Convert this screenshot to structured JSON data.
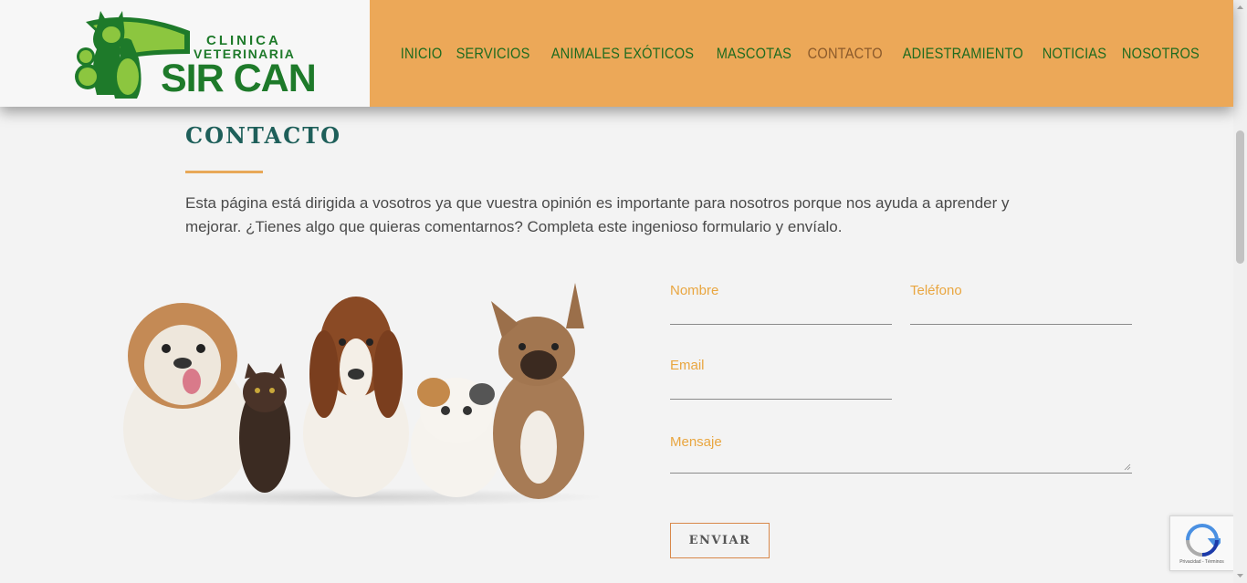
{
  "brand": {
    "line1": "CLINICA",
    "line2": "VETERINARIA",
    "line3": "SIR CAN",
    "colors": {
      "green": "#1e7a2a",
      "lightgreen": "#8cc63f"
    }
  },
  "nav": {
    "items": [
      {
        "label": "INICIO"
      },
      {
        "label": "SERVICIOS"
      },
      {
        "label": "ANIMALES EXÓTICOS"
      },
      {
        "label": "MASCOTAS"
      },
      {
        "label": "CONTACTO",
        "active": true
      },
      {
        "label": "ADIESTRAMIENTO"
      },
      {
        "label": "NOTICIAS"
      },
      {
        "label": "NOSOTROS"
      }
    ],
    "background": "#eca858"
  },
  "page": {
    "title": "CONTACTO",
    "intro": "Esta página está dirigida a vosotros ya que vuestra opinión es importante para nosotros porque nos ayuda a aprender y mejorar. ¿Tienes algo que quieras comentarnos? Completa este ingenioso formulario y envíalo."
  },
  "form": {
    "nombre_label": "Nombre",
    "telefono_label": "Teléfono",
    "email_label": "Email",
    "mensaje_label": "Mensaje",
    "submit_label": "ENVIAR"
  },
  "recaptcha": {
    "footer": "Privacidad - Términos"
  },
  "colors": {
    "accent": "#e8a858",
    "label": "#e9a640",
    "title": "#1e5f5a"
  }
}
